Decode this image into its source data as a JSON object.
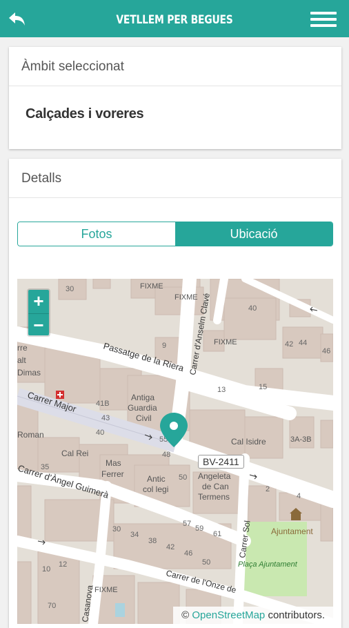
{
  "header": {
    "title": "VETLLEM PER BEGUES",
    "back_icon": "back-arrow-icon",
    "menu_icon": "hamburger-menu-icon"
  },
  "ambit_card": {
    "header": "Àmbit seleccionat",
    "value": "Calçades i voreres"
  },
  "details_card": {
    "header": "Detalls",
    "tabs": [
      {
        "label": "Fotos",
        "active": false
      },
      {
        "label": "Ubicació",
        "active": true
      }
    ]
  },
  "map": {
    "zoom_in": "+",
    "zoom_out": "−",
    "attribution_prefix": "©",
    "attribution_link": "OpenStreetMap",
    "attribution_suffix": "contributors.",
    "road_badge": "BV-2411",
    "labels": {
      "passatge": "Passatge de la Riera",
      "carrer_major": "Carrer Major",
      "anselm": "Carrer d'Anselm Clavé",
      "guimera": "Carrer d'Àngel Guimerà",
      "sol": "Carrer Sol",
      "casanova": "Casanova",
      "onze": "Carrer de l'Onze de",
      "guardia_1": "Antiga",
      "guardia_2": "Guardia",
      "guardia_3": "Civil",
      "cal_isidre": "Cal Isidre",
      "cal_rei": "Cal Rei",
      "mas_1": "Mas",
      "mas_2": "Ferrer",
      "antic_1": "Antic",
      "antic_2": "col legi",
      "angeleta_1": "Angeleta",
      "angeleta_2": "de Can",
      "angeleta_3": "Termens",
      "ajuntament": "Ajuntament",
      "placa": "Plaça Ajuntament",
      "roman": "Roman",
      "dimas": "Dimas",
      "rre": "rre",
      "alt": "alt",
      "fixme": "FIXME",
      "sq_3a": "3A-3B"
    },
    "numbers": [
      "30",
      "9",
      "13",
      "15",
      "40",
      "42",
      "44",
      "46",
      "41B",
      "43",
      "40",
      "55",
      "48",
      "50",
      "35",
      "57",
      "59",
      "61",
      "30",
      "34",
      "38",
      "42",
      "46",
      "50",
      "10",
      "12",
      "70",
      "2",
      "4"
    ]
  }
}
